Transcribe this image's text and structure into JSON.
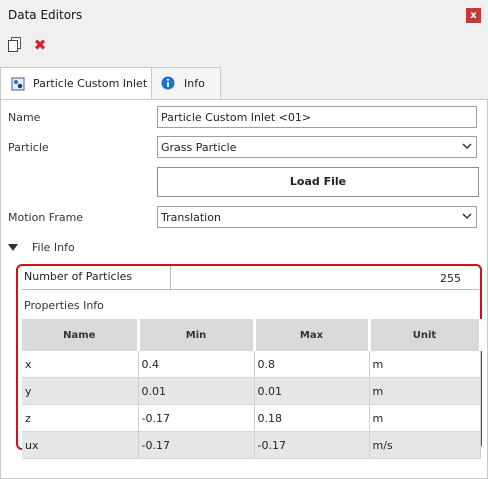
{
  "window": {
    "title": "Data Editors",
    "close_label": "x"
  },
  "toolbar": {
    "copy_icon": "copy-document-icon",
    "delete_icon": "delete-x-icon",
    "delete_glyph": "✖"
  },
  "tabs": [
    {
      "label": "Particle Custom Inlet",
      "icon": "particle-inlet-icon",
      "active": true
    },
    {
      "label": "Info",
      "icon": "info-circle-icon",
      "active": false
    }
  ],
  "form": {
    "name_label": "Name",
    "name_value": "Particle Custom Inlet <01>",
    "particle_label": "Particle",
    "particle_value": "Grass Particle",
    "load_file_button": "Load File",
    "motion_frame_label": "Motion Frame",
    "motion_frame_value": "Translation"
  },
  "file_info": {
    "section_label": "File Info",
    "num_particles_label": "Number of Particles",
    "num_particles_value": "255",
    "properties_label": "Properties Info",
    "columns": [
      "Name",
      "Min",
      "Max",
      "Unit"
    ],
    "rows": [
      {
        "name": "x",
        "min": "0.4",
        "max": "0.8",
        "unit": "m"
      },
      {
        "name": "y",
        "min": "0.01",
        "max": "0.01",
        "unit": "m"
      },
      {
        "name": "z",
        "min": "-0.17",
        "max": "0.18",
        "unit": "m"
      },
      {
        "name": "ux",
        "min": "-0.17",
        "max": "-0.17",
        "unit": "m/s"
      }
    ]
  },
  "colors": {
    "highlight_border": "#d4101e",
    "delete_red": "#d4202a",
    "info_blue": "#1a73c9"
  }
}
